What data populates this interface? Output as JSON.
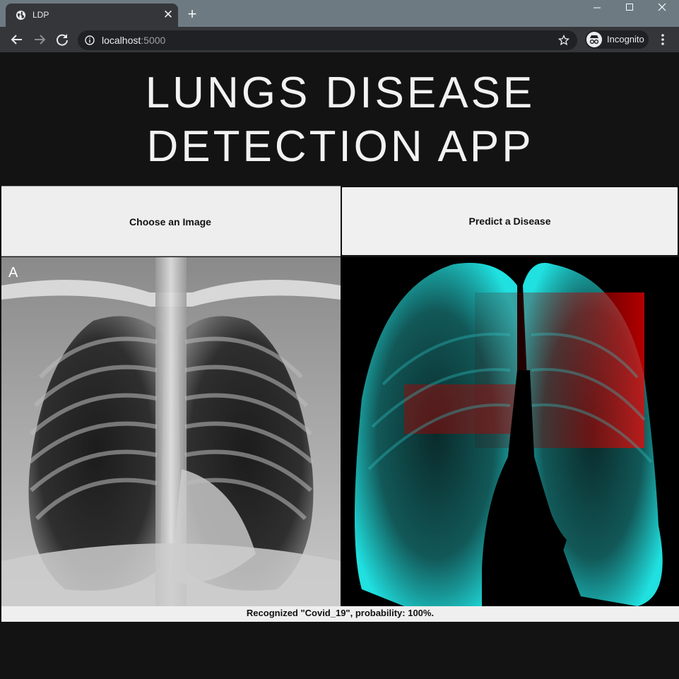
{
  "browser": {
    "tab_title": "LDP",
    "url_host": "localhost",
    "url_port": ":5000",
    "profile_label": "Incognito",
    "colors": {
      "tabstrip": "#6d7a82",
      "toolbar": "#35363a",
      "omnibox": "#202124"
    }
  },
  "app": {
    "title_line1": "LUNGS DISEASE",
    "title_line2": "DETECTION APP",
    "choose_label": "Choose an Image",
    "predict_label": "Predict a Disease",
    "result_text": "Recognized \"Covid_19\", probability: 100%.",
    "xray_letter": "A",
    "colors": {
      "background": "#131313",
      "button": "#eeeeee",
      "heat_cyan": "#00e5e5",
      "heat_red": "#ff0000"
    }
  }
}
